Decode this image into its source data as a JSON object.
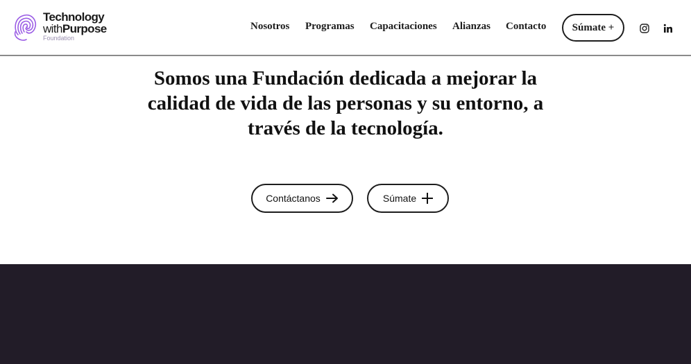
{
  "brand": {
    "line1": "Technology",
    "line2_a": "with",
    "line2_b": "Purpose",
    "line3": "Foundation",
    "accent_color": "#9b5de5"
  },
  "nav": {
    "items": [
      {
        "label": "Nosotros"
      },
      {
        "label": "Programas"
      },
      {
        "label": "Capacitaciones"
      },
      {
        "label": "Alianzas"
      },
      {
        "label": "Contacto"
      }
    ],
    "join_button": "Súmate +"
  },
  "social": {
    "icons": [
      "instagram-icon",
      "linkedin-icon"
    ]
  },
  "hero": {
    "title": "Somos una Fundación dedicada a mejorar la calidad de vida de las personas y su entorno, a través de la tecnología.",
    "contact_button": "Contáctanos",
    "contact_icon": "arrow-right-icon",
    "join_button": "Súmate",
    "join_icon": "plus-icon"
  },
  "colors": {
    "dark_band": "#221c28",
    "header_border": "#8a8a8a"
  }
}
